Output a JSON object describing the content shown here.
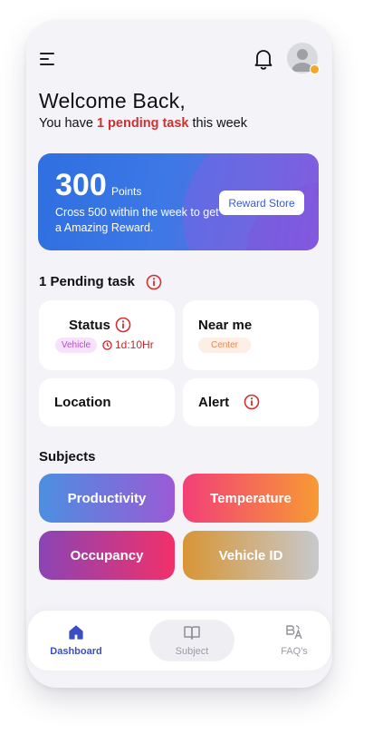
{
  "header": {
    "welcome": "Welcome Back,",
    "sub_prefix": "You have ",
    "sub_highlight": "1 pending task",
    "sub_suffix": " this week"
  },
  "points_card": {
    "points": "300",
    "unit": "Points",
    "description": "Cross 500 within the week to get a Amazing Reward.",
    "reward_button": "Reward Store"
  },
  "pending": {
    "title": "1 Pending task",
    "cards": {
      "status": {
        "title": "Status",
        "chip": "Vehicle",
        "timer": "1d:10Hr"
      },
      "near_me": {
        "title": "Near me",
        "chip": "Center"
      },
      "location": {
        "title": "Location"
      },
      "alert": {
        "title": "Alert"
      }
    }
  },
  "subjects": {
    "title": "Subjects",
    "items": [
      {
        "label": "Productivity"
      },
      {
        "label": "Temperature"
      },
      {
        "label": "Occupancy"
      },
      {
        "label": "Vehicle ID"
      }
    ]
  },
  "nav": {
    "items": [
      {
        "label": "Dashboard",
        "icon": "home-icon",
        "active": true
      },
      {
        "label": "Subject",
        "icon": "book-icon",
        "active": false
      },
      {
        "label": "FAQ's",
        "icon": "translate-icon",
        "active": false
      }
    ]
  },
  "colors": {
    "accent": "#3b4fc4",
    "alert_red": "#d32f2f",
    "background": "#f4f3f8"
  }
}
